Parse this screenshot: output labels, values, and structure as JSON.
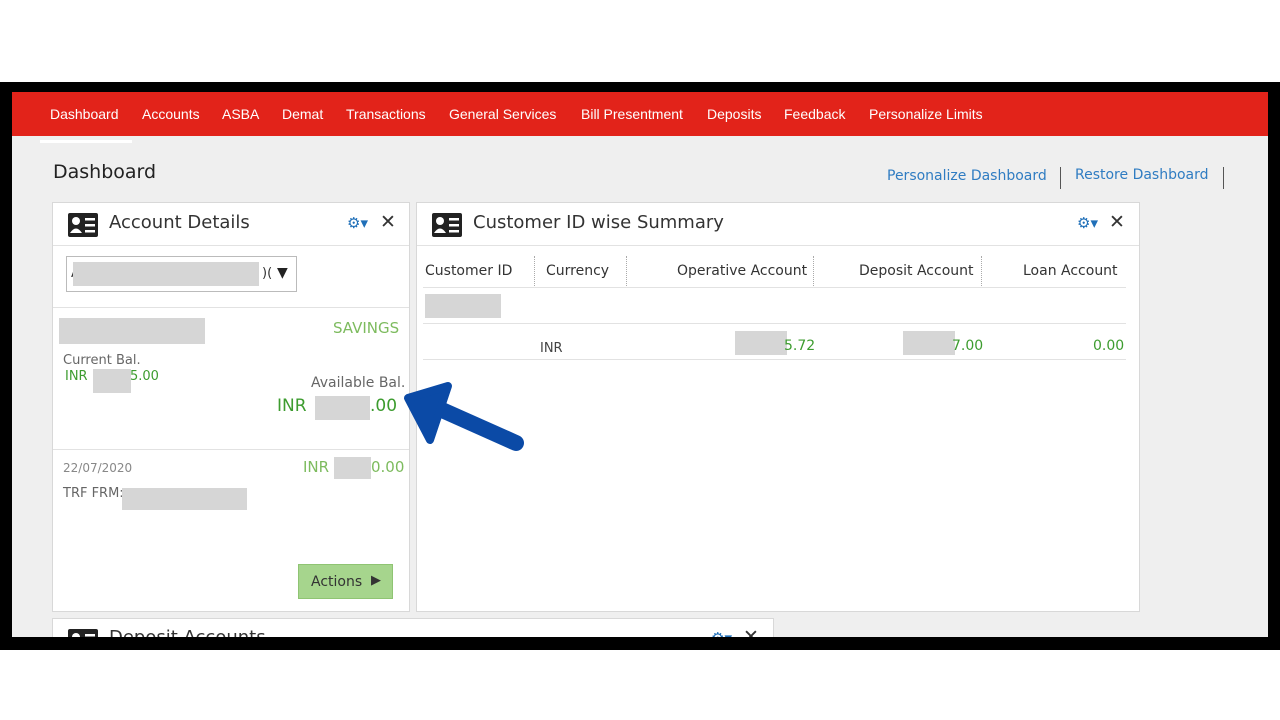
{
  "nav": {
    "items": [
      "Dashboard",
      "Accounts",
      "ASBA",
      "Demat",
      "Transactions",
      "General Services",
      "Bill Presentment",
      "Deposits",
      "Feedback",
      "Personalize Limits"
    ]
  },
  "page": {
    "title": "Dashboard",
    "personalize_link": "Personalize Dashboard",
    "restore_link": "Restore Dashboard"
  },
  "account_panel": {
    "title": "Account Details",
    "select_prefix": "A",
    "select_suffix": ")(",
    "account_type": "SAVINGS",
    "current_label": "Current Bal.",
    "current_prefix": "INR",
    "current_suffix": "5.00",
    "available_label": "Available Bal.",
    "available_prefix": "INR",
    "available_suffix": ".00",
    "txn_date": "22/07/2020",
    "txn_prefix": "INR",
    "txn_suffix": "0.00",
    "txn_desc": "TRF FRM:",
    "actions_label": "Actions"
  },
  "summary_panel": {
    "title": "Customer ID wise Summary",
    "columns": [
      "Customer ID",
      "Currency",
      "Operative Account",
      "Deposit Account",
      "Loan Account"
    ],
    "row": {
      "currency": "INR",
      "operative_suffix": "5.72",
      "deposit_suffix": "7.00",
      "loan": "0.00"
    }
  },
  "deposit_panel": {
    "title": "Deposit Accounts"
  },
  "colors": {
    "nav_bg": "#e2231a",
    "link": "#2f7cc2",
    "green": "#3d9c2f",
    "button": "#a6d58d",
    "arrow": "#0b4aa6"
  }
}
